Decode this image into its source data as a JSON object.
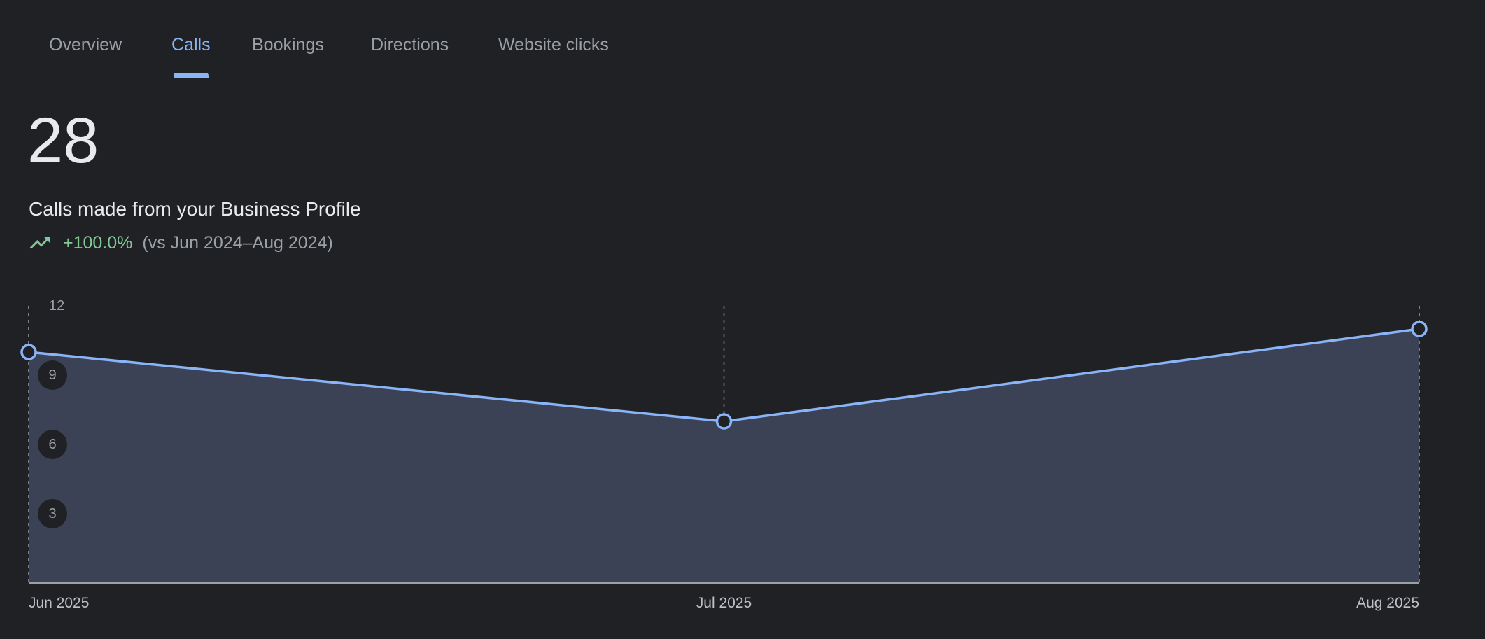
{
  "tabs": [
    {
      "label": "Overview"
    },
    {
      "label": "Calls"
    },
    {
      "label": "Bookings"
    },
    {
      "label": "Directions"
    },
    {
      "label": "Website clicks"
    }
  ],
  "active_tab": "Calls",
  "metric": {
    "value": "28",
    "description": "Calls made from your Business Profile",
    "change": "+100.0%",
    "comparison": "(vs Jun 2024–Aug 2024)",
    "trend_icon": "trending-up-icon"
  },
  "colors": {
    "background": "#202124",
    "accent": "#8ab4f8",
    "positive": "#81c995",
    "area_fill": "#3c4256",
    "muted_text": "#9aa0a6"
  },
  "chart_data": {
    "type": "area",
    "categories": [
      "Jun 2025",
      "Jul 2025",
      "Aug 2025"
    ],
    "values": [
      10,
      7,
      11
    ],
    "ylim": [
      0,
      12
    ],
    "yticks": [
      3,
      6,
      9,
      12
    ],
    "title": "",
    "xlabel": "",
    "ylabel": "",
    "grid": "dashed vertical lines at each month"
  }
}
